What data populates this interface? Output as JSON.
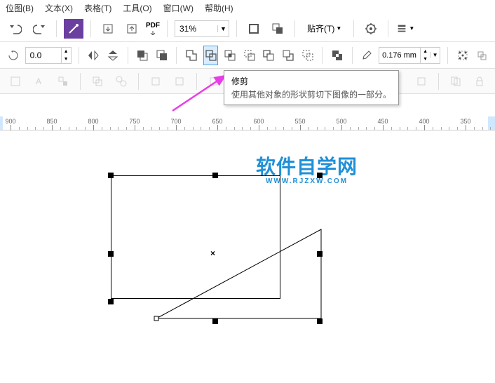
{
  "menu": {
    "bitmap": "位图(B)",
    "text": "文本(X)",
    "table": "表格(T)",
    "tools": "工具(O)",
    "window": "窗口(W)",
    "help": "帮助(H)"
  },
  "toolbar1": {
    "pdf_label": "PDF",
    "zoom_value": "31%",
    "align_label": "贴齐(T)"
  },
  "toolbar2": {
    "rotation_value": "0.0",
    "outline_value": "0.176 mm"
  },
  "tooltip": {
    "title": "修剪",
    "desc": "使用其他对象的形状剪切下图像的一部分。"
  },
  "ruler": {
    "ticks": [
      "900",
      "850",
      "800",
      "750",
      "700",
      "650",
      "600",
      "550",
      "500",
      "450",
      "400",
      "350"
    ]
  },
  "watermark": {
    "line1": "软件自学网",
    "line2": "WWW.RJZXW.COM"
  },
  "colors": {
    "accent": "#2090d8",
    "active_bg": "#d9ecff",
    "active_border": "#4aa3e0"
  }
}
